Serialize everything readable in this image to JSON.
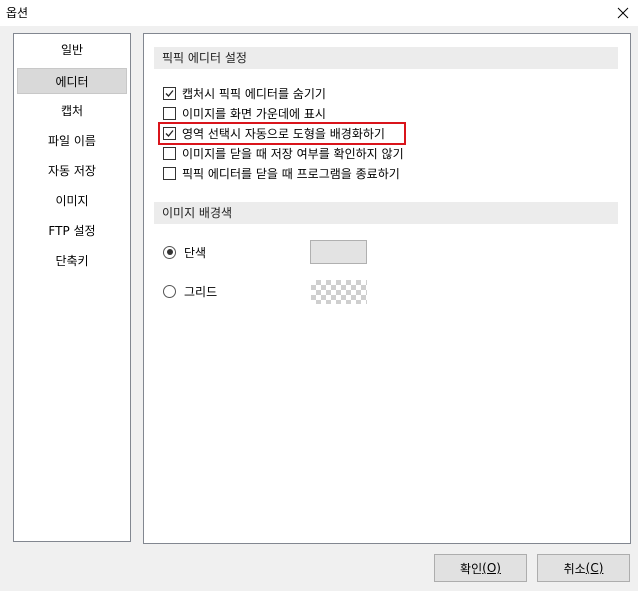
{
  "window": {
    "title": "옵션",
    "close_icon": "close-icon"
  },
  "nav": {
    "items": [
      {
        "label": "일반",
        "selected": false
      },
      {
        "label": "에디터",
        "selected": true
      },
      {
        "label": "캡처",
        "selected": false
      },
      {
        "label": "파일 이름",
        "selected": false
      },
      {
        "label": "자동 저장",
        "selected": false
      },
      {
        "label": "이미지",
        "selected": false
      },
      {
        "label": "FTP 설정",
        "selected": false
      },
      {
        "label": "단축키",
        "selected": false
      }
    ]
  },
  "editor_settings": {
    "header": "픽픽 에디터 설정",
    "options": [
      {
        "label": "캡처시 픽픽 에디터를 숨기기",
        "checked": true
      },
      {
        "label": "이미지를 화면 가운데에 표시",
        "checked": false
      },
      {
        "label": "영역 선택시 자동으로 도형을 배경화하기",
        "checked": true
      },
      {
        "label": "이미지를 닫을 때 저장 여부를 확인하지 않기",
        "checked": false
      },
      {
        "label": "픽픽 에디터를 닫을 때 프로그램을 종료하기",
        "checked": false
      }
    ]
  },
  "background": {
    "header": "이미지 배경색",
    "options": [
      {
        "label": "단색",
        "checked": true
      },
      {
        "label": "그리드",
        "checked": false
      }
    ],
    "solid_color": "#e3e3e3"
  },
  "buttons": {
    "ok_label": "확인",
    "ok_mnemonic": "(O)",
    "cancel_label": "취소",
    "cancel_mnemonic": "(C)"
  },
  "colors": {
    "highlight": "#d9141b"
  }
}
